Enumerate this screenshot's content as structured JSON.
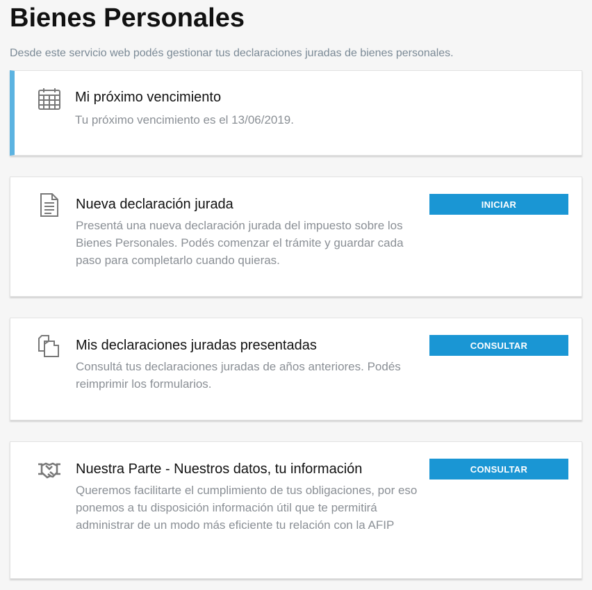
{
  "header": {
    "title": "Bienes Personales",
    "subtitle": "Desde este servicio web podés gestionar tus declaraciones juradas de bienes personales."
  },
  "cards": [
    {
      "icon": "calendar-icon",
      "title": "Mi próximo vencimiento",
      "desc": "Tu próximo vencimiento es el 13/06/2019."
    },
    {
      "icon": "document-icon",
      "title": "Nueva declaración jurada",
      "desc": "Presentá una nueva declaración jurada del impuesto sobre los Bienes Personales. Podés comenzar el trámite y guardar cada paso para completarlo cuando quieras.",
      "button": "INICIAR"
    },
    {
      "icon": "copies-icon",
      "title": "Mis declaraciones juradas presentadas",
      "desc": "Consultá tus declaraciones juradas de años anteriores. Podés reimprimir los formularios.",
      "button": "CONSULTAR"
    },
    {
      "icon": "handshake-icon",
      "title": "Nuestra Parte - Nuestros datos, tu información",
      "desc": "Queremos facilitarte el cumplimiento de tus obligaciones, por eso ponemos a tu disposición información útil que te permitirá administrar de un modo más eficiente tu relación con la AFIP",
      "button": "CONSULTAR"
    }
  ],
  "colors": {
    "accent": "#1a96d4",
    "border_accent": "#5cb3e1"
  }
}
